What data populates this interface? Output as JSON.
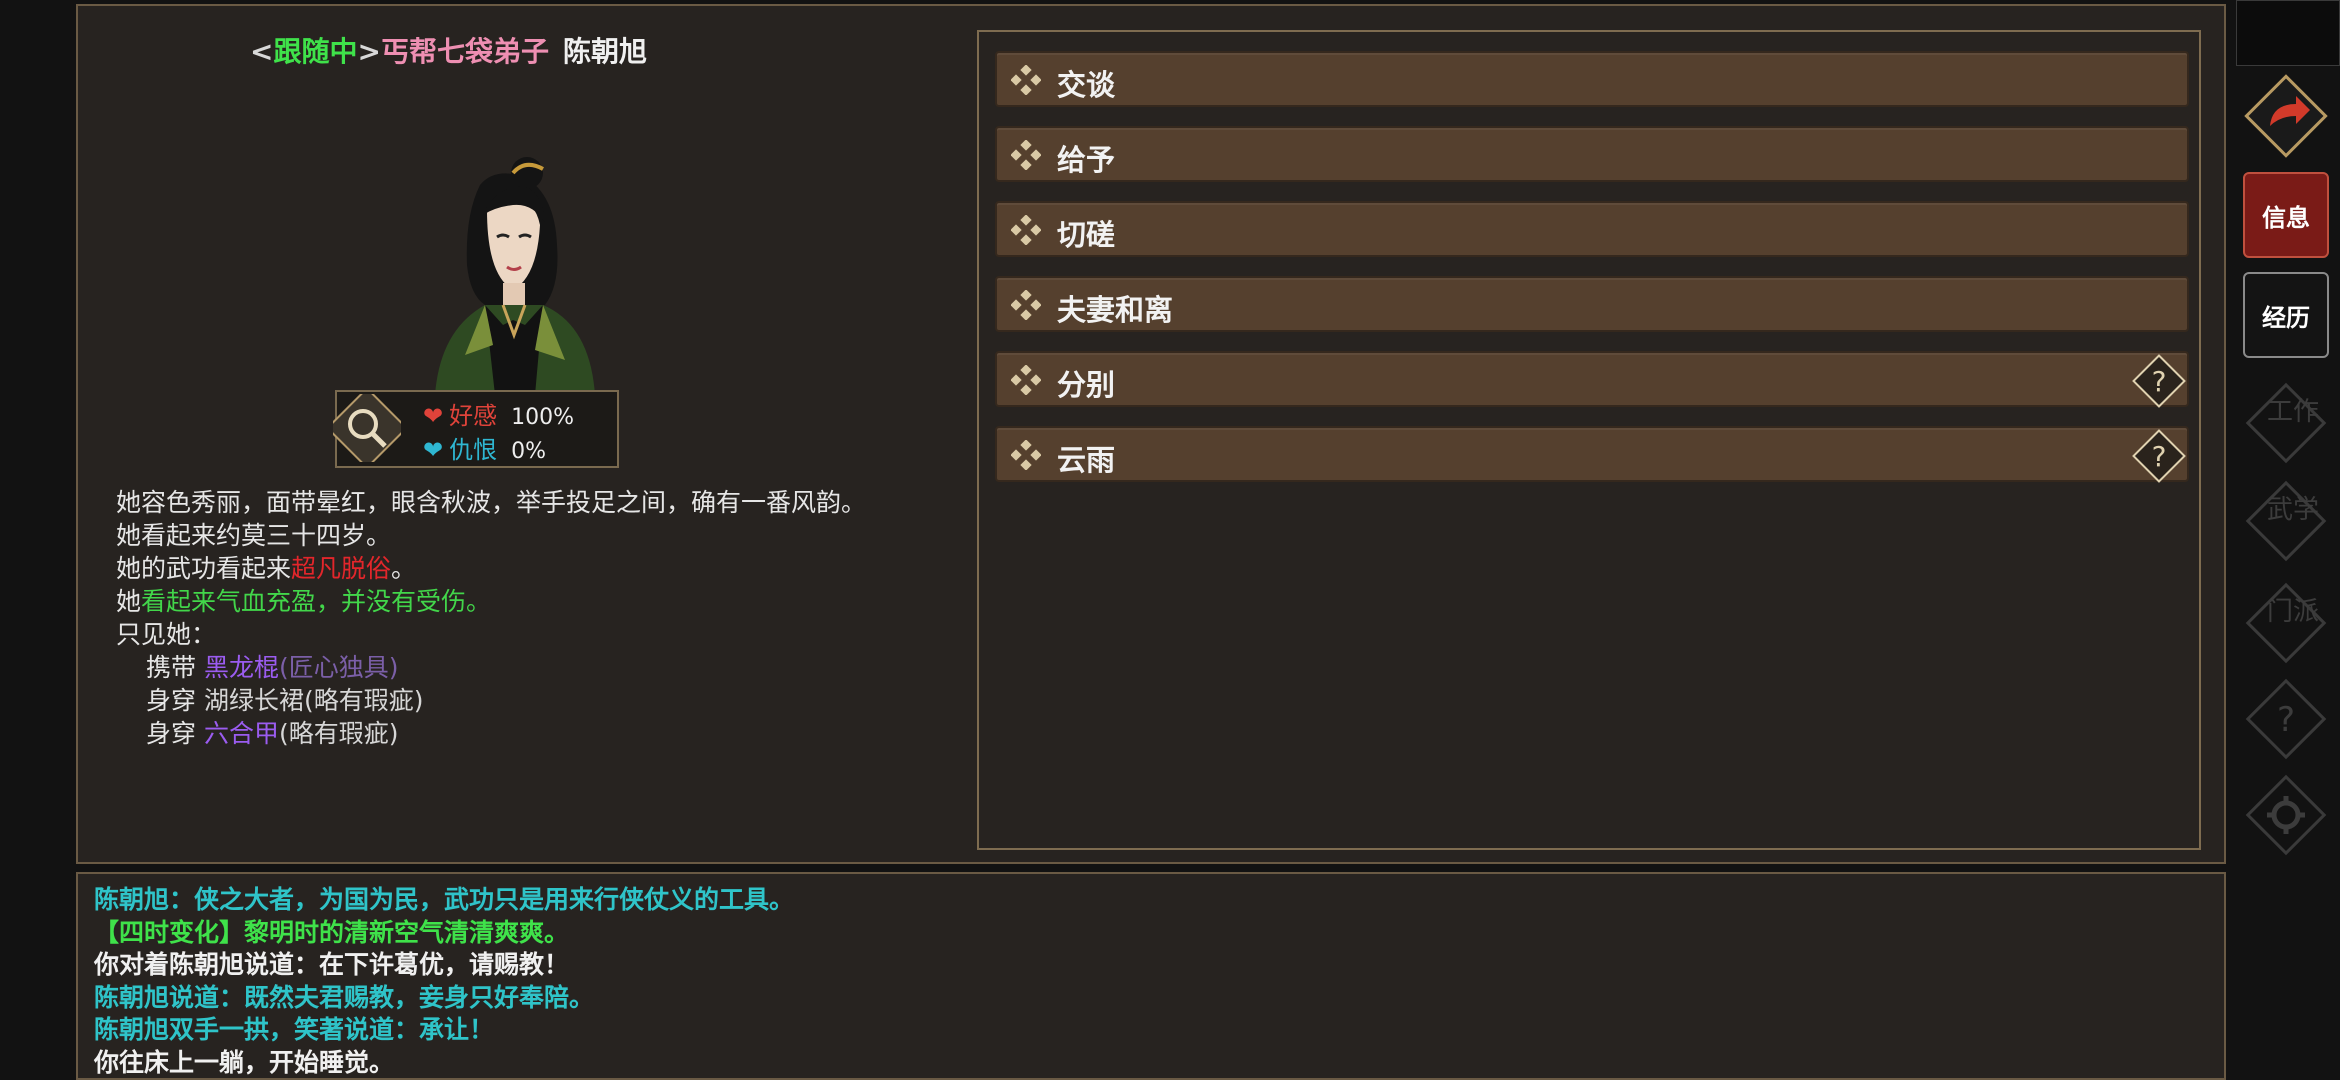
{
  "header": {
    "bracket_open": "<",
    "status": "跟随中",
    "bracket_close": ">",
    "title": "丐帮七袋弟子",
    "name": "陈朝旭"
  },
  "stats": {
    "affection_label": "好感",
    "affection_value": "100%",
    "hatred_label": "仇恨",
    "hatred_value": "0%"
  },
  "description": {
    "line1": "她容色秀丽，面带晕红，眼含秋波，举手投足之间，确有一番风韵。",
    "line2": "她看起来约莫三十四岁。",
    "line3_prefix": "她的武功看起来",
    "line3_value": "超凡脱俗",
    "line3_suffix": "。",
    "line4_prefix": "她",
    "line4_value": "看起来气血充盈，并没有受伤。",
    "line5": "只见她：",
    "equip": [
      {
        "verb": "携带",
        "item": "黑龙棍",
        "quality": "(匠心独具)"
      },
      {
        "verb": "身穿",
        "item": "湖绿长裙",
        "quality": "(略有瑕疵)"
      },
      {
        "verb": "身穿",
        "item": "六合甲",
        "quality": "(略有瑕疵)"
      }
    ]
  },
  "actions": [
    {
      "label": "交谈"
    },
    {
      "label": "给予"
    },
    {
      "label": "切磋"
    },
    {
      "label": "夫妻和离"
    },
    {
      "label": "分别",
      "help": "?"
    },
    {
      "label": "云雨",
      "help": "?"
    }
  ],
  "log": [
    {
      "text": "陈朝旭：侠之大者，为国为民，武功只是用来行侠仗义的工具。",
      "color": "#2fc4c9"
    },
    {
      "tag": "【四时变化】",
      "text": "黎明时的清新空气清清爽爽。",
      "color": "#3fe24a"
    },
    {
      "text": "你对着陈朝旭说道：在下许葛优，请赐教！",
      "color": "#f0f0f0"
    },
    {
      "text": "陈朝旭说道：既然夫君赐教，妾身只好奉陪。",
      "color": "#2fc4c9"
    },
    {
      "text": "陈朝旭双手一拱，笑著说道：承让！",
      "color": "#2fc4c9"
    },
    {
      "text": "你往床上一躺，开始睡觉。",
      "color": "#f0f0f0"
    }
  ],
  "sidebar": {
    "info_label": "信息",
    "history_label": "经历",
    "dim_items": [
      "工作",
      "武学",
      "门派"
    ]
  },
  "colors": {
    "panel_bg": "#272320",
    "border": "#6a5a44",
    "action_bg": "#55402e",
    "active_tab": "#7a1b17"
  }
}
